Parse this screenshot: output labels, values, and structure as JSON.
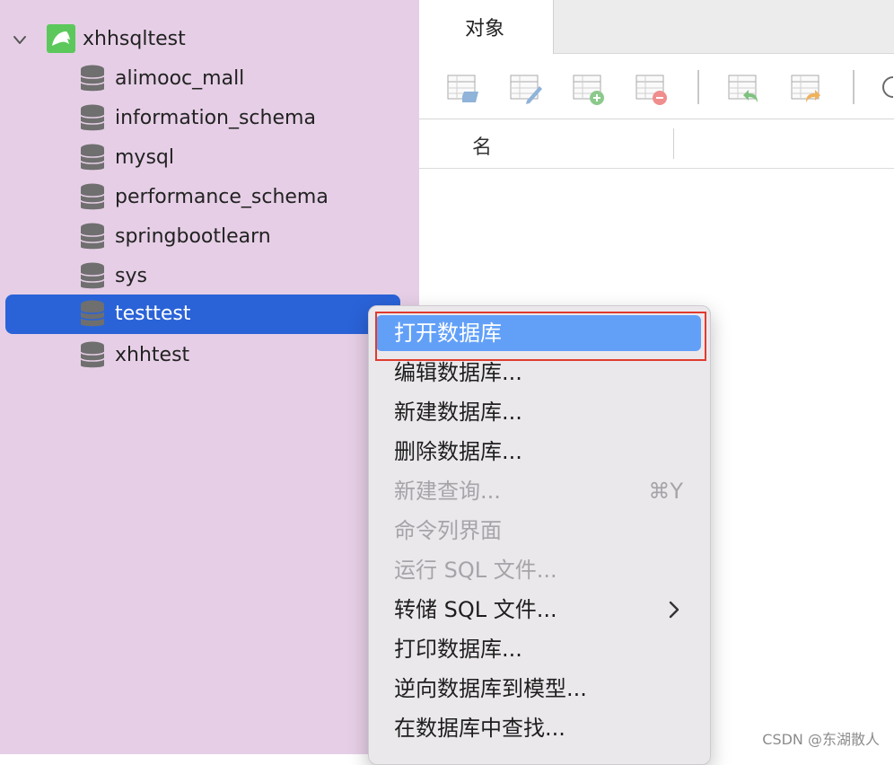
{
  "sidebar": {
    "connection": {
      "label": "xhhsqltest",
      "icon": "mysql-dolphin-icon"
    },
    "databases": [
      {
        "label": "alimooc_mall"
      },
      {
        "label": "information_schema"
      },
      {
        "label": "mysql"
      },
      {
        "label": "performance_schema"
      },
      {
        "label": "springbootlearn"
      },
      {
        "label": "sys"
      },
      {
        "label": "testtest",
        "selected": true
      },
      {
        "label": "xhhtest"
      }
    ]
  },
  "main": {
    "tab": "对象",
    "column_header": "名",
    "toolbar_icons": [
      "open-table-icon",
      "design-table-icon",
      "new-table-icon",
      "delete-table-icon",
      "import-wizard-icon",
      "export-wizard-icon"
    ]
  },
  "context_menu": {
    "items": [
      {
        "label": "打开数据库",
        "highlighted": true
      },
      {
        "label": "编辑数据库..."
      },
      {
        "label": "新建数据库..."
      },
      {
        "label": "删除数据库..."
      },
      {
        "label": "新建查询...",
        "disabled": true,
        "shortcut": "⌘Y"
      },
      {
        "label": "命令列界面",
        "disabled": true
      },
      {
        "label": "运行 SQL 文件...",
        "disabled": true
      },
      {
        "label": "转储 SQL 文件...",
        "submenu": true
      },
      {
        "label": "打印数据库..."
      },
      {
        "label": "逆向数据库到模型..."
      },
      {
        "label": "在数据库中查找..."
      }
    ]
  },
  "watermark": "CSDN @东湖散人",
  "colors": {
    "sidebar_bg": "#e6cfe6",
    "selection": "#2a63d8",
    "menu_highlight": "#62a0f8",
    "annotation_box": "#e03b2e"
  }
}
